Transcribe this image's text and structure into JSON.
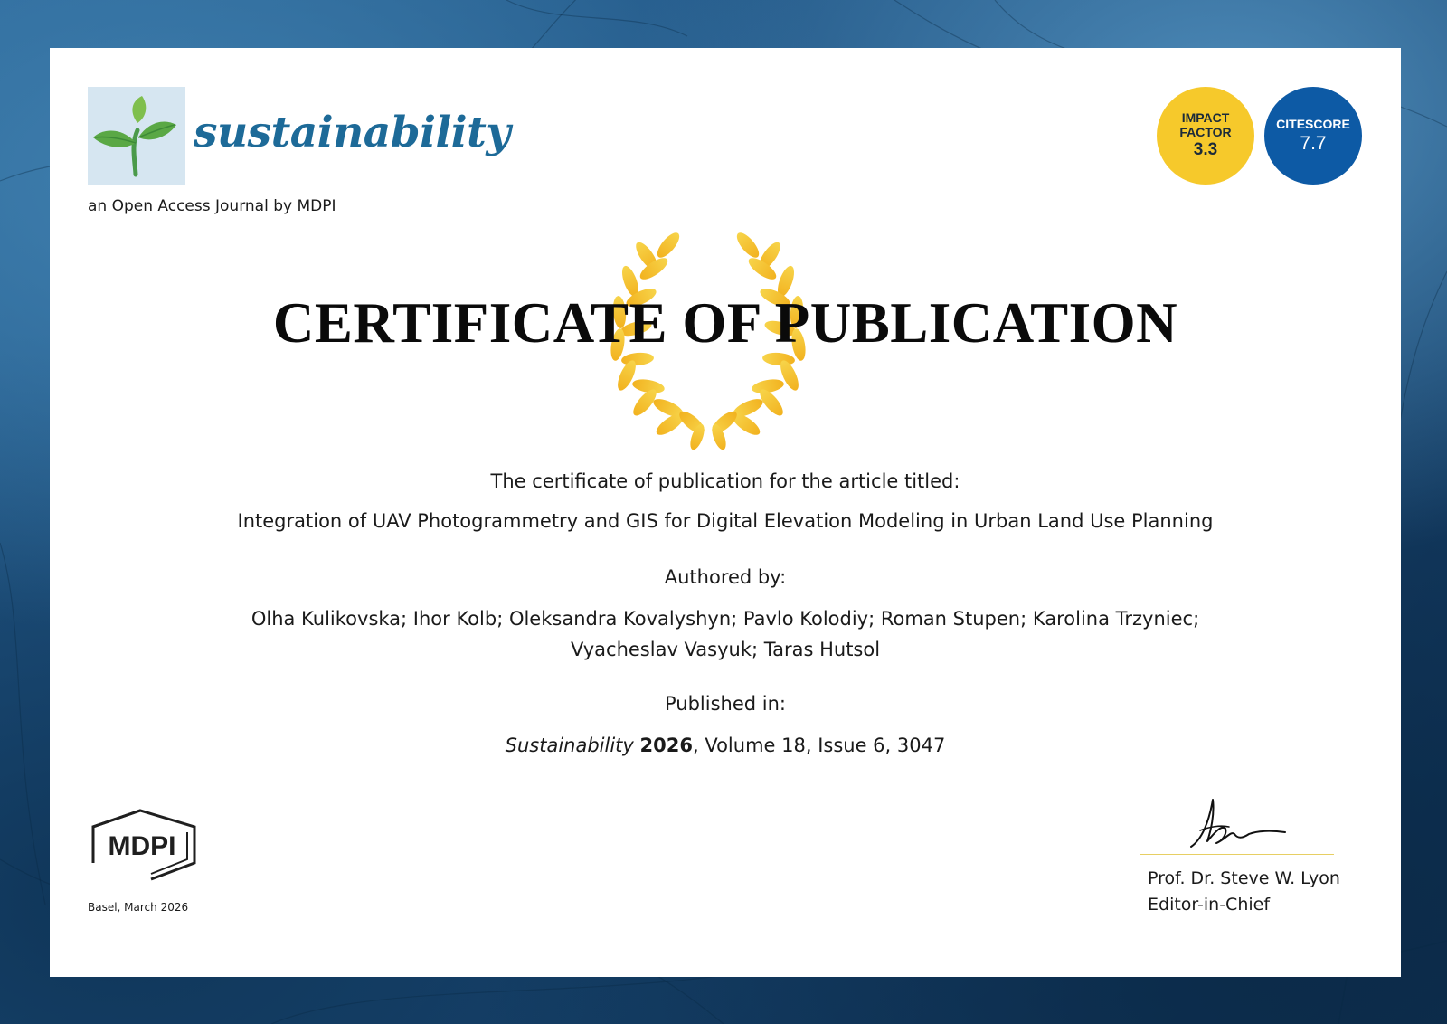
{
  "journal": {
    "name": "sustainability",
    "subtitle": "an Open Access Journal by MDPI",
    "brand_color": "#1d6a98",
    "logo_icon": "sprout-icon"
  },
  "badges": {
    "impact_factor": {
      "label": "IMPACT FACTOR",
      "value": "3.3",
      "color": "#f6c92b"
    },
    "citescore": {
      "label": "CITESCORE",
      "value": "7.7",
      "color": "#0d5aa5"
    }
  },
  "certificate": {
    "title": "CERTIFICATE OF PUBLICATION",
    "emblem": "laurel-wreath-icon",
    "intro": "The certificate of publication for the article titled:",
    "article_title": "Integration of UAV Photogrammetry and GIS for Digital Elevation Modeling in Urban Land Use Planning",
    "authored_label": "Authored by:",
    "authors_line1": "Olha Kulikovska; Ihor Kolb; Oleksandra Kovalyshyn; Pavlo Kolodiy; Roman Stupen; Karolina Trzyniec;",
    "authors_line2": "Vyacheslav Vasyuk; Taras Hutsol",
    "published_label": "Published in:",
    "citation": {
      "journal": "Sustainability",
      "year": "2026",
      "rest": ", Volume 18, Issue 6, 3047"
    }
  },
  "publisher": {
    "logo_text": "MDPI",
    "place_date": "Basel, March 2026"
  },
  "editor": {
    "name": "Prof. Dr. Steve W. Lyon",
    "role": "Editor-in-Chief",
    "signature_icon": "handwritten-signature"
  }
}
